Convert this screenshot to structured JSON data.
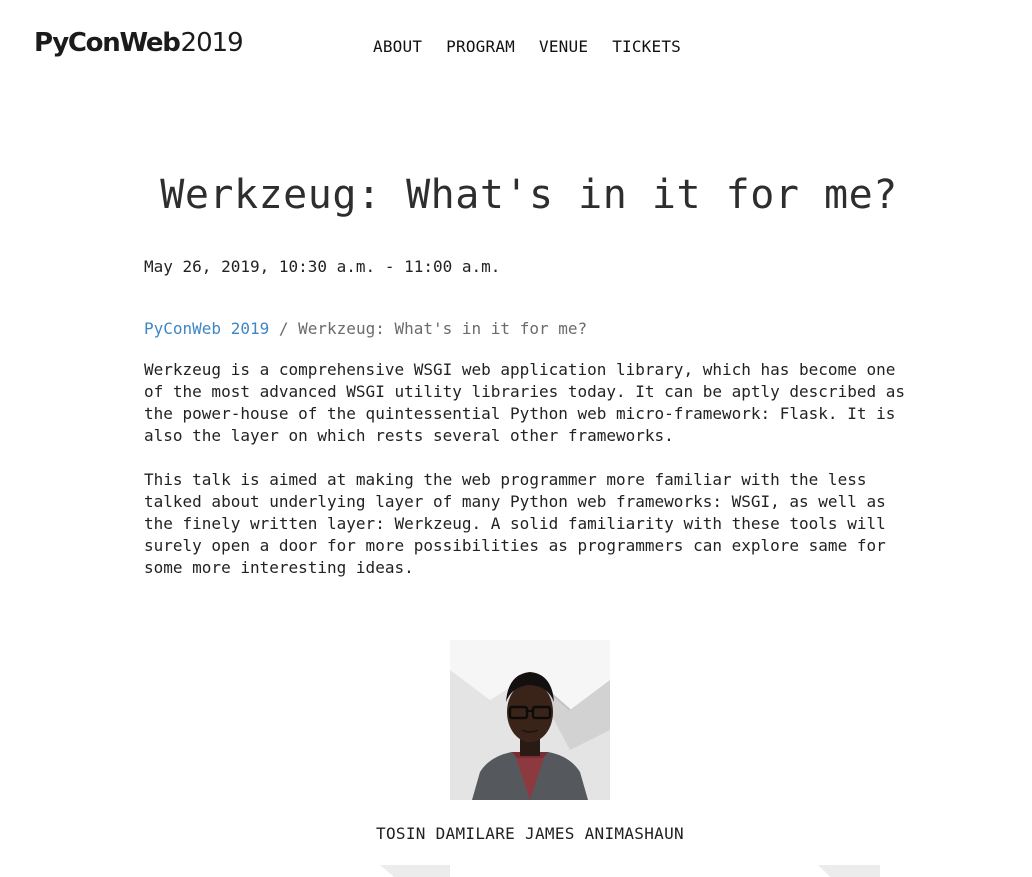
{
  "header": {
    "logo_brand": "PyConWeb",
    "logo_year": "2019",
    "nav": [
      "ABOUT",
      "PROGRAM",
      "VENUE",
      "TICKETS"
    ]
  },
  "talk": {
    "title": "Werkzeug: What's in it for me?",
    "datetime": "May 26, 2019, 10:30 a.m. - 11:00 a.m.",
    "breadcrumb_link": "PyConWeb 2019",
    "breadcrumb_sep": " / ",
    "breadcrumb_current": "Werkzeug: What's in it for me?",
    "paragraphs": [
      "Werkzeug is a comprehensive WSGI web application library, which has become one of the most advanced WSGI utility libraries today. It can be aptly described as the power-house of the quintessential Python web micro-framework: Flask. It is also the layer on which rests several other frameworks.",
      "This talk is aimed at making the web programmer more familiar with the less talked about underlying layer of many Python web frameworks: WSGI, as well as the finely written layer: Werkzeug. A solid familiarity with these tools will surely open a door for more possibilities as programmers can explore same for some more interesting ideas."
    ]
  },
  "speaker": {
    "name": "TOSIN DAMILARE JAMES ANIMASHAUN"
  }
}
